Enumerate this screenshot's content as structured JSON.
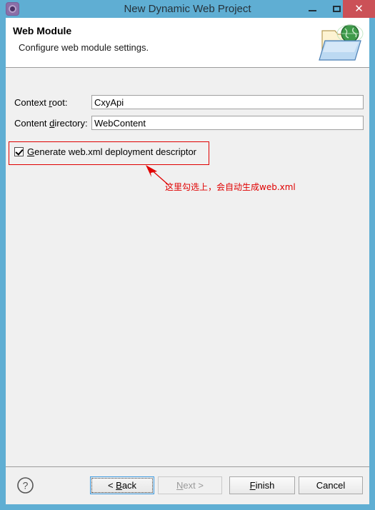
{
  "window": {
    "title": "New Dynamic Web Project",
    "icon": "gear-icon",
    "controls": {
      "minimize": "–",
      "maximize": "□",
      "close": "✕"
    },
    "accent_color": "#5faed3",
    "close_color": "#cb5157"
  },
  "header": {
    "title": "Web Module",
    "subtitle": "Configure web module settings.",
    "icon": "web-folder-globe-icon"
  },
  "form": {
    "context_root": {
      "label_pre": "Context ",
      "label_mnemonic": "r",
      "label_post": "oot:",
      "value": "CxyApi"
    },
    "content_directory": {
      "label_pre": "Content ",
      "label_mnemonic": "d",
      "label_post": "irectory:",
      "value": "WebContent"
    },
    "generate_webxml": {
      "label_mnemonic": "G",
      "label_post": "enerate web.xml deployment descriptor",
      "checked": true,
      "highlight_color": "#e00000"
    }
  },
  "annotation": {
    "text": "这里勾选上，会自动生成web.xml",
    "color": "#e00000",
    "arrow": "red-arrow-up-left"
  },
  "buttons": {
    "help": "?",
    "back": {
      "pre": "< ",
      "mnemonic": "B",
      "post": "ack",
      "focused": true
    },
    "next": {
      "mnemonic": "N",
      "post": "ext >",
      "disabled": true
    },
    "finish": {
      "mnemonic": "F",
      "post": "inish"
    },
    "cancel": {
      "label": "Cancel"
    }
  }
}
